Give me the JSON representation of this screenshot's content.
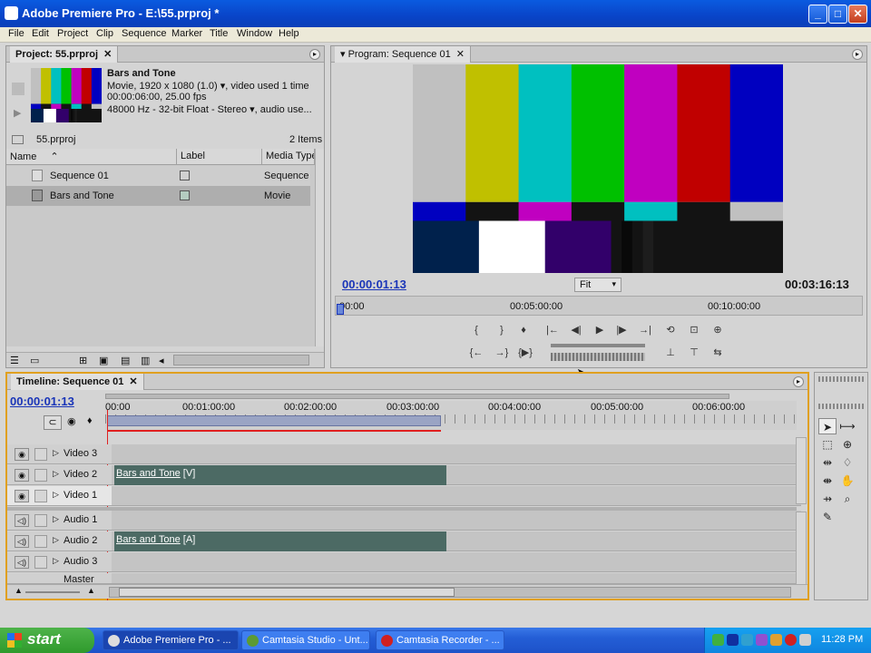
{
  "window": {
    "title": "Adobe Premiere Pro - E:\\55.prproj *",
    "min": "_",
    "max": "□",
    "close": "✕"
  },
  "menu": [
    "File",
    "Edit",
    "Project",
    "Clip",
    "Sequence",
    "Marker",
    "Title",
    "Window",
    "Help"
  ],
  "project": {
    "tab": "Project: 55.prproj",
    "clip_name": "Bars and Tone",
    "clip_info1": "Movie, 1920 x 1080 (1.0)",
    "clip_info1_suffix": ", video used 1 time",
    "clip_info2": "00:00:06:00, 25.00 fps",
    "clip_info3": "48000 Hz - 32-bit Float - Stereo",
    "clip_info3_suffix": ", audio use...",
    "file": "55.prproj",
    "count": "2 Items",
    "columns": [
      "Name",
      "Label",
      "Media Type"
    ],
    "items": [
      {
        "name": "Sequence 01",
        "type": "Sequence",
        "label_color": "#d0d0d0"
      },
      {
        "name": "Bars and Tone",
        "type": "Movie",
        "label_color": "#b4ccc0"
      }
    ]
  },
  "program": {
    "tab": "Program: Sequence 01",
    "timecode": "00:00:01:13",
    "fit": "Fit",
    "duration": "00:03:16:13",
    "ruler": [
      "00:00",
      "00:05:00:00",
      "00:10:00:00"
    ],
    "bars_top": [
      "#c0c0c0",
      "#c0c000",
      "#00c0c0",
      "#00c000",
      "#c000c0",
      "#c00000",
      "#0000c0"
    ],
    "bars_mid": [
      "#0000c0",
      "#131313",
      "#c000c0",
      "#131313",
      "#00c0c0",
      "#131313",
      "#c0c0c0"
    ],
    "bars_bot": [
      "#00214c",
      "#ffffff",
      "#32006a",
      "#131313",
      "#090909",
      "#131313",
      "#1d1d1d",
      "#131313"
    ]
  },
  "timeline": {
    "tab": "Timeline: Sequence 01",
    "timecode": "00:00:01:13",
    "ruler": [
      "00:00",
      "00:01:00:00",
      "00:02:00:00",
      "00:03:00:00",
      "00:04:00:00",
      "00:05:00:00",
      "00:06:00:00"
    ],
    "video_tracks": [
      "Video 3",
      "Video 2",
      "Video 1"
    ],
    "audio_tracks": [
      "Audio 1",
      "Audio 2",
      "Audio 3",
      "Master"
    ],
    "video_clip": {
      "name": "Bars and Tone",
      "suffix": " [V]"
    },
    "audio_clip": {
      "name": "Bars and Tone",
      "suffix": " [A]"
    }
  },
  "taskbar": {
    "start": "start",
    "items": [
      "Adobe Premiere Pro - ...",
      "Camtasia Studio - Unt...",
      "Camtasia Recorder - ..."
    ],
    "clock": "11:28 PM"
  }
}
